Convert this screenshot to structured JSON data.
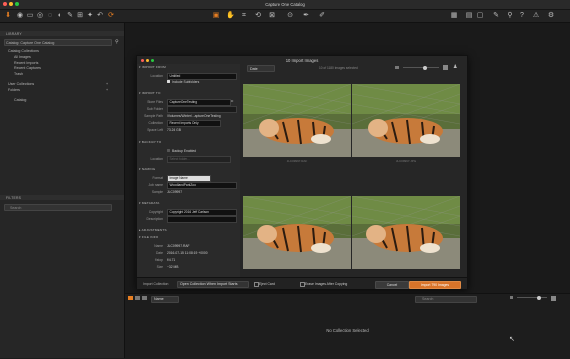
{
  "app": {
    "title": "Capture One Catalog",
    "traffic_lights": [
      "#ff5f57",
      "#febc2e",
      "#28c840"
    ]
  },
  "toolbar": {
    "left_icons": [
      "import-icon",
      "camera-icon",
      "folder-icon",
      "capture-icon",
      "lens-icon",
      "exposure-icon",
      "metadata-icon",
      "brush-icon",
      "adjustments-icon",
      "undo-icon",
      "redo-icon",
      "process-icon"
    ],
    "center_icons": [
      "pan-icon",
      "select-icon",
      "crop-icon",
      "rotate-icon",
      "keystone-icon",
      "spot-icon",
      "picker-icon",
      "annotate-icon"
    ],
    "right_icons": [
      "grid-icon",
      "browser-icon",
      "viewer-icon",
      "fullscreen-icon",
      "pen-icon",
      "loupe-icon",
      "help-icon",
      "exposure-warning-icon",
      "settings-icon"
    ]
  },
  "sidebar": {
    "library_label": "LIBRARY",
    "catalog_select": "Catalog: Capture One Catalog",
    "catalog_collections_label": "Catalog Collections",
    "collections": [
      "All Images",
      "Recent Imports",
      "Recent Captures",
      "Trash"
    ],
    "user_collections_label": "User Collections",
    "folders_label": "Folders",
    "folders_item": "Catalog",
    "filters_label": "FILTERS",
    "search_placeholder": "Search"
  },
  "dialog": {
    "title": "10 Import Images",
    "sections": {
      "import_from": "IMPORT FROM",
      "import_to": "IMPORT TO",
      "backup_to": "BACKUP TO",
      "naming": "NAMING",
      "metadata": "METADATA",
      "adjustments": "ADJUSTMENTS",
      "file_info": "FILE INFO"
    },
    "import_from": {
      "location_label": "Location",
      "location_value": "Untitled",
      "include_subfolders": "Include Subfolders"
    },
    "import_to": {
      "store_files_label": "Store Files",
      "store_files_value": "CaptureOneTesting",
      "sub_folder_label": "Sub Folder",
      "sub_folder_value": "",
      "sample_path_label": "Sample Path",
      "sample_path_value": "/Volumes/Winter/...aptureOneTesting",
      "collection_label": "Collection",
      "collection_value": "Recent Imports Only",
      "space_left_label": "Space Left",
      "space_left_value": "73.24 GB"
    },
    "backup_to": {
      "backup_enabled": "Backup Enabled",
      "location_label": "Location",
      "location_value": "Select folder..."
    },
    "naming": {
      "format_label": "Format",
      "format_value": "Image Name",
      "job_name_label": "Job name",
      "job_name_value": "WoodlandParkZoo",
      "sample_label": "Sample",
      "sample_value": "JLC09997"
    },
    "metadata": {
      "copyright_label": "Copyright",
      "copyright_value": "Copyright 2016 Jeff Carlson",
      "description_label": "Description",
      "description_value": ""
    },
    "file_info": {
      "name_label": "Name",
      "name_value": "JLC09997.RAF",
      "date_label": "Date",
      "date_value": "2016-07-15 11:08:19 +0000",
      "fstop_label": "f/stop",
      "fstop_value": "f/4.71",
      "size_label": "Size",
      "size_value": "~32 MB"
    },
    "grid": {
      "sort_value": "Date",
      "count_text": "10 of 1180 images selected",
      "thumbs": [
        {
          "label": "JLC09997.RAF"
        },
        {
          "label": "JLC09997.JPG"
        },
        {
          "label": ""
        },
        {
          "label": ""
        }
      ]
    },
    "bottom": {
      "import_collection_label": "Import Collection",
      "import_collection_value": "Open Collection When Import Starts",
      "eject_card": "Eject Card",
      "erase_images": "Erase Images After Copying",
      "cancel": "Cancel",
      "import_button": "Import 790 Images"
    }
  },
  "viewer": {
    "sort_value": "Name",
    "search_placeholder": "Search",
    "empty_message": "No Collection Selected"
  },
  "colors": {
    "accent": "#e67e22",
    "import_button": "#d9742a"
  }
}
